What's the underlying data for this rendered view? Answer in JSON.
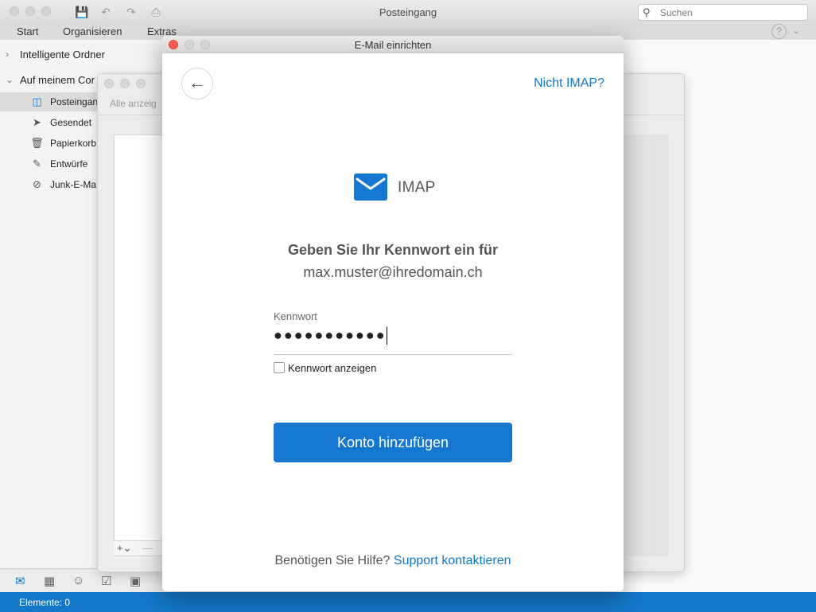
{
  "window": {
    "title": "Posteingang"
  },
  "search": {
    "placeholder": "Suchen"
  },
  "ribbon": {
    "tabs": [
      "Start",
      "Organisieren",
      "Extras"
    ]
  },
  "sidebar": {
    "groups": [
      "Intelligente Ordner",
      "Auf meinem Cor"
    ],
    "items": [
      {
        "label": "Posteingan",
        "icon": "inbox-icon"
      },
      {
        "label": "Gesendet",
        "icon": "sent-icon"
      },
      {
        "label": "Papierkorb",
        "icon": "trash-icon"
      },
      {
        "label": "Entwürfe",
        "icon": "drafts-icon"
      },
      {
        "label": "Junk-E-Ma",
        "icon": "junk-icon"
      }
    ]
  },
  "status": {
    "text": "Elemente: 0"
  },
  "background_dialog": {
    "filter_label": "Alle anzeig"
  },
  "dialog": {
    "title": "E-Mail einrichten",
    "not_imap": "Nicht IMAP?",
    "account_type": "IMAP",
    "prompt": "Geben Sie Ihr Kennwort ein für",
    "email": "max.muster@ihredomain.ch",
    "password_label": "Kennwort",
    "password_value": "●●●●●●●●●●●",
    "show_password": "Kennwort anzeigen",
    "add_account": "Konto hinzufügen",
    "help_text": "Benötigen Sie Hilfe?",
    "help_link": "Support kontaktieren"
  },
  "colors": {
    "accent": "#1577d0",
    "status_bar": "#1478c8",
    "link": "#0f76c5"
  }
}
